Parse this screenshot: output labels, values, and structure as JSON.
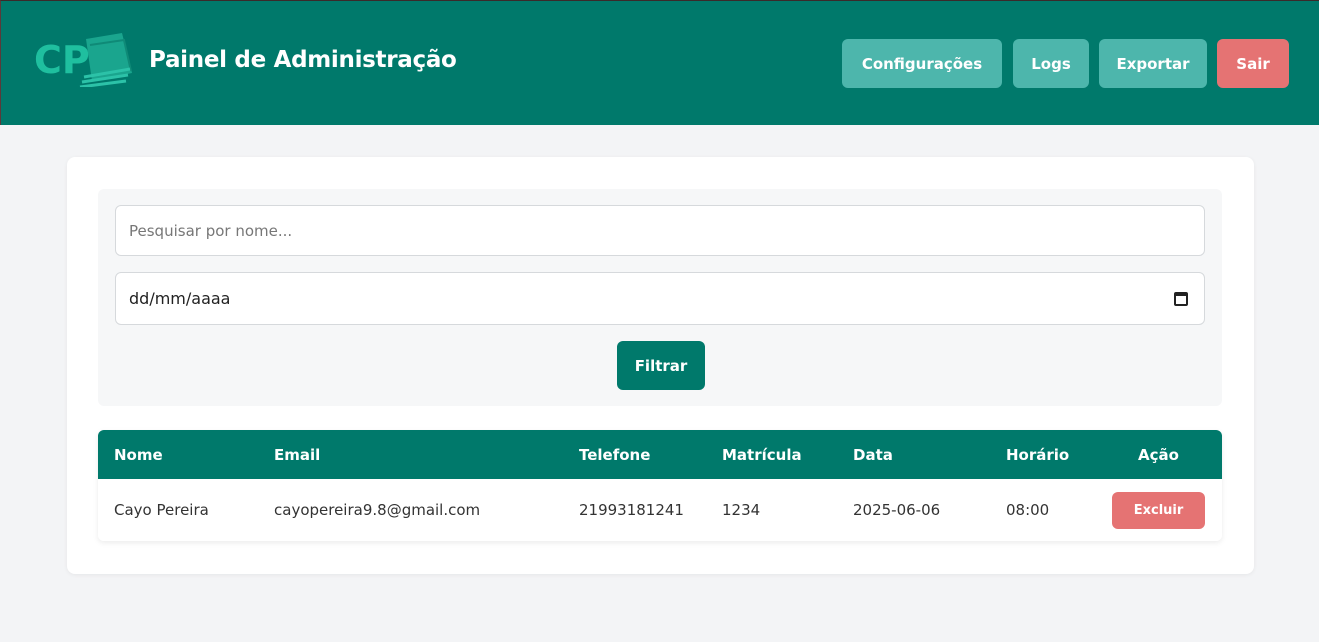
{
  "header": {
    "title": "Painel de Administração",
    "logo_text": "CP",
    "buttons": {
      "settings": "Configurações",
      "logs": "Logs",
      "export": "Exportar",
      "logout": "Sair"
    }
  },
  "filters": {
    "search_placeholder": "Pesquisar por nome...",
    "date_placeholder": "dd/mm/aaaa",
    "filter_button": "Filtrar"
  },
  "table": {
    "columns": [
      "Nome",
      "Email",
      "Telefone",
      "Matrícula",
      "Data",
      "Horário",
      "Ação"
    ],
    "rows": [
      {
        "nome": "Cayo Pereira",
        "email": "cayopereira9.8@gmail.com",
        "telefone": "21993181241",
        "matricula": "1234",
        "data": "2025-06-06",
        "horario": "08:00",
        "action": "Excluir"
      }
    ]
  },
  "colors": {
    "primary": "#00796b",
    "secondary_button": "#4db6ac",
    "danger": "#e57373",
    "background": "#f3f4f6"
  }
}
